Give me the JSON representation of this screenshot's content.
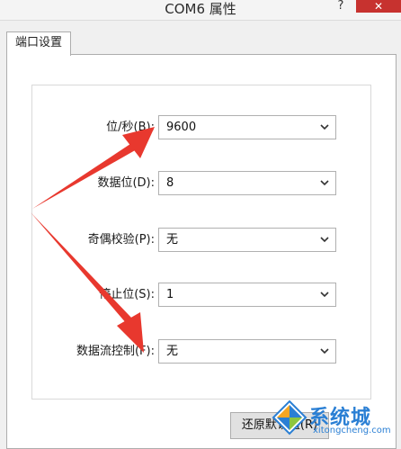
{
  "window": {
    "title": "COM6 属性",
    "help": "?",
    "close": "✕"
  },
  "tabs": [
    {
      "label": "端口设置"
    }
  ],
  "settings": [
    {
      "label": "位/秒(B):",
      "value": "9600"
    },
    {
      "label": "数据位(D):",
      "value": "8"
    },
    {
      "label": "奇偶校验(P):",
      "value": "无"
    },
    {
      "label": "停止位(S):",
      "value": "1"
    },
    {
      "label": "数据流控制(F):",
      "value": "无"
    }
  ],
  "buttons": {
    "restore_defaults": "还原默认值(R)"
  },
  "watermark": {
    "text": "系统城",
    "url": "xitongcheng.com"
  },
  "colors": {
    "arrow": "#e8382e",
    "close": "#c7322f",
    "watermark": "#2a7fd4"
  }
}
